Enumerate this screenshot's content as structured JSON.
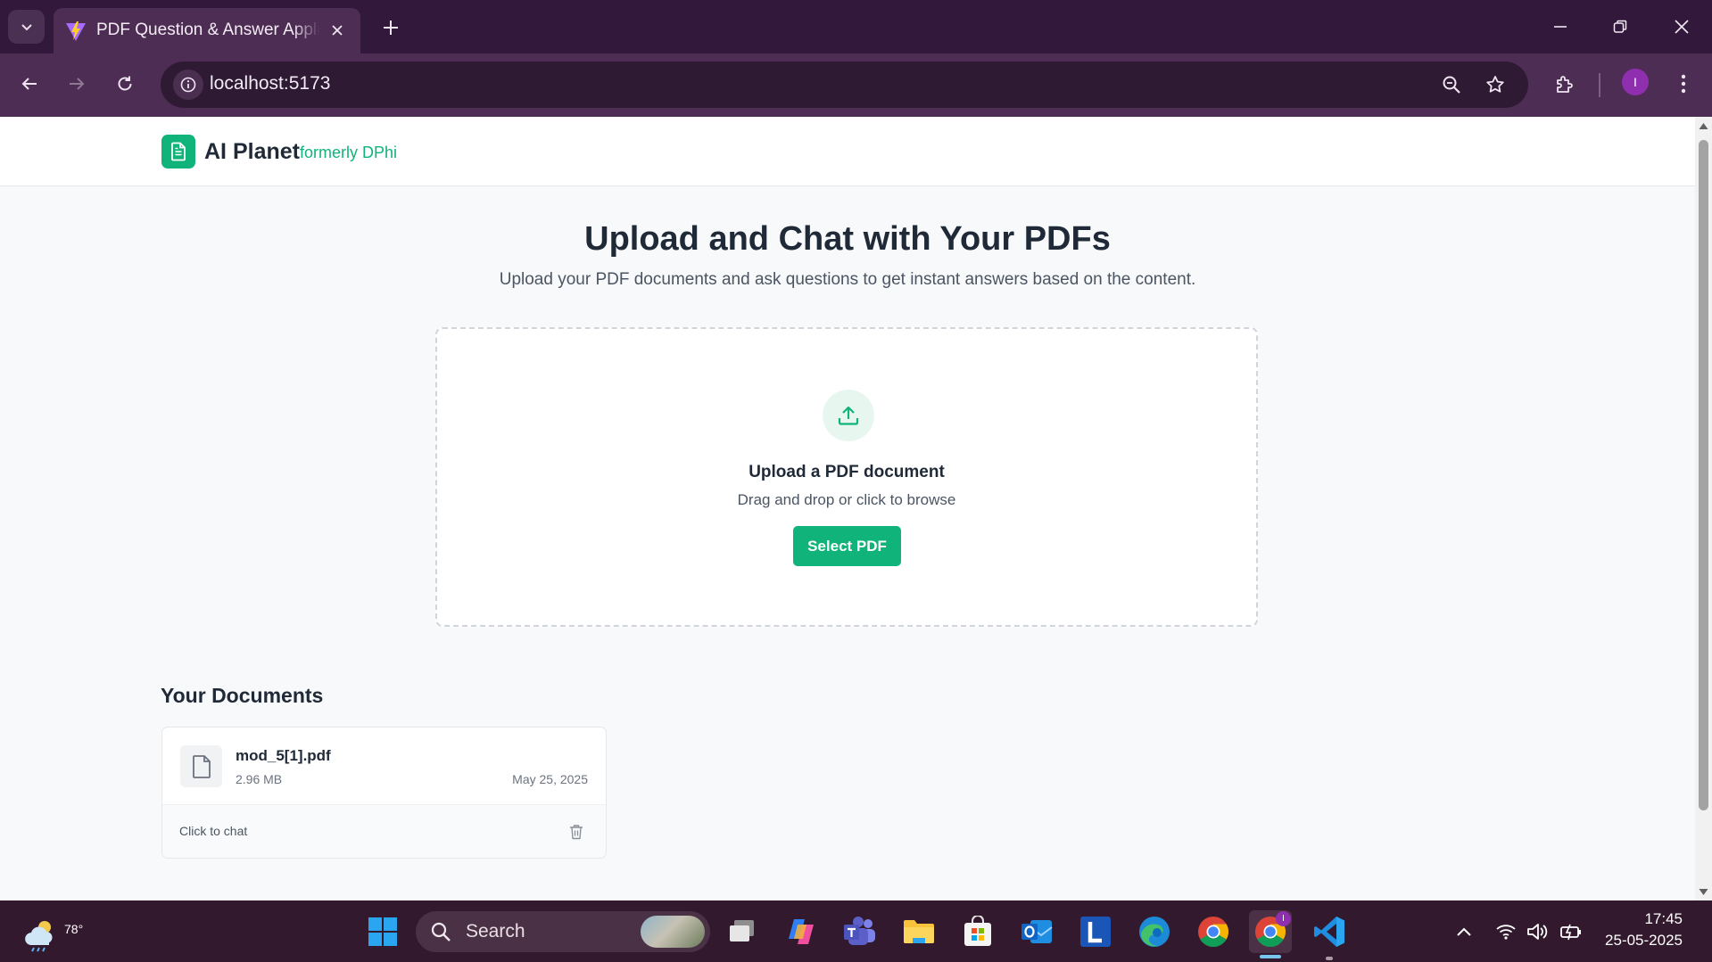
{
  "browser": {
    "tab_title": "PDF Question & Answer Application",
    "url": "localhost:5173",
    "profile_initial": "I"
  },
  "site": {
    "brand": "AI Planet",
    "brand_sub": "formerly DPhi",
    "accent_color": "#10b47a"
  },
  "hero": {
    "title": "Upload and Chat with Your PDFs",
    "subtitle": "Upload your PDF documents and ask questions to get instant answers based on the content."
  },
  "upload": {
    "title": "Upload a PDF document",
    "subtitle": "Drag and drop or click to browse",
    "button": "Select PDF"
  },
  "documents": {
    "title": "Your Documents",
    "items": [
      {
        "name": "mod_5[1].pdf",
        "size": "2.96 MB",
        "date": "May 25, 2025",
        "action": "Click to chat"
      }
    ]
  },
  "taskbar": {
    "temperature": "78°",
    "search_label": "Search",
    "time": "17:45",
    "date": "25-05-2025",
    "teams_badge": "I"
  }
}
